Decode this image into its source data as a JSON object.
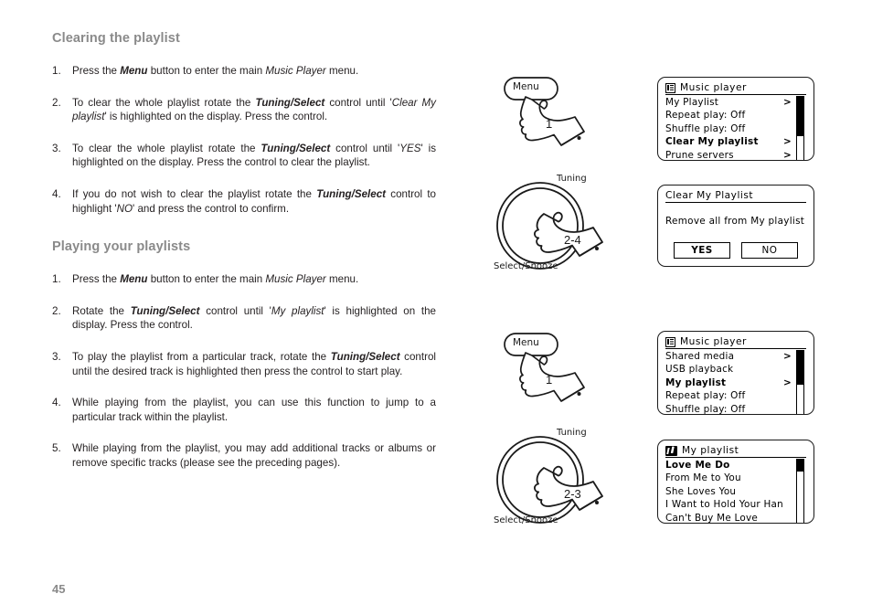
{
  "page": {
    "number": "45"
  },
  "sections": [
    {
      "heading": "Clearing the playlist",
      "steps": [
        {
          "num": "1.",
          "html": "Press the <b>Menu</b> button to enter the main <i>Music Player</i> menu."
        },
        {
          "num": "2.",
          "html": "To clear the whole playlist rotate the <b>Tuning/Select</b> control until '<i>Clear My playlist</i>' is highlighted on the display. Press the control."
        },
        {
          "num": "3.",
          "html": "To clear the whole playlist rotate the <b>Tuning/Select</b> control until '<i>YES</i>' is highlighted on the display. Press the control to clear the playlist."
        },
        {
          "num": "4.",
          "html": "If you do not wish to clear the playlist rotate the <b>Tuning/Select</b> control to highlight '<i>NO</i>' and press the control to confirm."
        }
      ]
    },
    {
      "heading": "Playing your playlists",
      "steps": [
        {
          "num": "1.",
          "html": "Press the <b>Menu</b> button to enter the main <i>Music Player</i> menu."
        },
        {
          "num": "2.",
          "html": "Rotate the <b>Tuning/Select</b> control until '<i>My playlist</i>' is highlighted on the display. Press the control."
        },
        {
          "num": "3.",
          "html": "To play the playlist from a particular track, rotate the <b>Tuning/Select</b> control until the desired track is highlighted then press the control to start play."
        },
        {
          "num": "4.",
          "html": "While playing from the playlist, you can use this function to jump to a particular track within the playlist."
        },
        {
          "num": "5.",
          "html": "While playing from the playlist, you may add additional tracks or albums or remove specific tracks (please see the preceding pages)."
        }
      ]
    }
  ],
  "figures": {
    "menu_button_1": {
      "button_label": "Menu",
      "step_number": "1",
      "icon": "hand-pressing-button-icon"
    },
    "menu_button_2": {
      "button_label": "Menu",
      "step_number": "1",
      "icon": "hand-pressing-button-icon"
    },
    "tuning_knob_1": {
      "top_label": "Tuning",
      "bottom_label": "Select/Snooze",
      "step_number": "2-4",
      "icon": "hand-rotating-knob-icon"
    },
    "tuning_knob_2": {
      "top_label": "Tuning",
      "bottom_label": "Select/Snooze",
      "step_number": "2-3",
      "icon": "hand-rotating-knob-icon"
    }
  },
  "displays": [
    {
      "id": "music-player-menu-1",
      "title": "Music player",
      "title_icon": "menu-list-icon",
      "rows": [
        {
          "label": "My Playlist",
          "chevron": ">",
          "selected": false
        },
        {
          "label": "Repeat play: Off",
          "chevron": "",
          "selected": false
        },
        {
          "label": "Shuffle play: Off",
          "chevron": "",
          "selected": false
        },
        {
          "label": "Clear My playlist",
          "chevron": ">",
          "selected": true
        },
        {
          "label": "Prune servers",
          "chevron": ">",
          "selected": false
        }
      ],
      "scroll": {
        "thumb_top_pct": 0,
        "thumb_height_pct": 60
      }
    },
    {
      "id": "clear-my-playlist-dialog",
      "title": "Clear My Playlist",
      "title_icon": "",
      "message": "Remove all from My playlist",
      "buttons": [
        {
          "label": "YES",
          "selected": true
        },
        {
          "label": "NO",
          "selected": false
        }
      ]
    },
    {
      "id": "music-player-menu-2",
      "title": "Music player",
      "title_icon": "menu-list-icon",
      "rows": [
        {
          "label": "Shared media",
          "chevron": ">",
          "selected": false
        },
        {
          "label": "USB playback",
          "chevron": "",
          "selected": false
        },
        {
          "label": "My playlist",
          "chevron": ">",
          "selected": true
        },
        {
          "label": "Repeat play: Off",
          "chevron": "",
          "selected": false
        },
        {
          "label": "Shuffle play: Off",
          "chevron": "",
          "selected": false
        }
      ],
      "scroll": {
        "thumb_top_pct": 0,
        "thumb_height_pct": 52
      }
    },
    {
      "id": "my-playlist-tracks",
      "title": "My playlist",
      "title_icon": "music-note-icon",
      "rows": [
        {
          "label": "Love Me Do",
          "chevron": "",
          "selected": true
        },
        {
          "label": "From Me to You",
          "chevron": "",
          "selected": false
        },
        {
          "label": "She Loves You",
          "chevron": "",
          "selected": false
        },
        {
          "label": "I Want to Hold Your Han",
          "chevron": "",
          "selected": false
        },
        {
          "label": "Can't Buy Me Love",
          "chevron": "",
          "selected": false
        }
      ],
      "scroll": {
        "thumb_top_pct": 0,
        "thumb_height_pct": 17
      }
    }
  ]
}
